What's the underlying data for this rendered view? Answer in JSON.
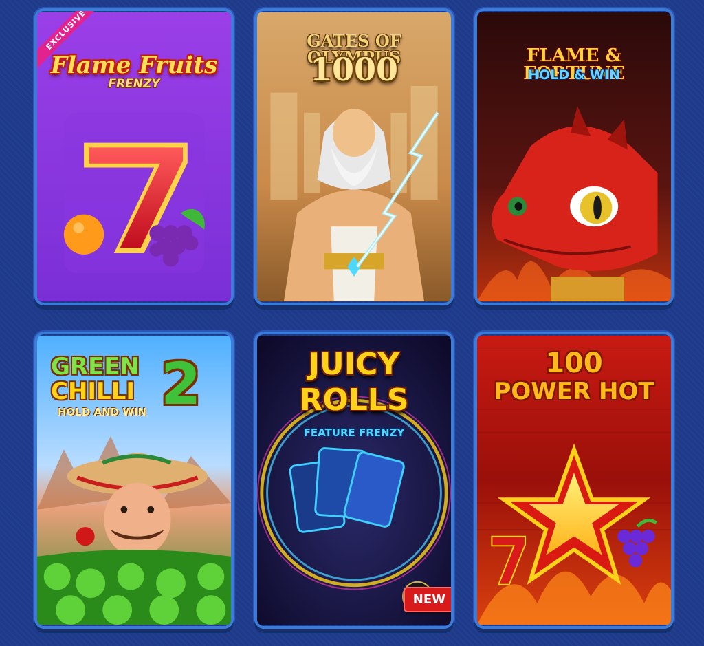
{
  "games": [
    {
      "id": "flame-fruits",
      "title": "Flame Fruits",
      "subtitle": "FRENZY",
      "badge": "EXCLUSIVE"
    },
    {
      "id": "gates-olympus",
      "title": "GATES OF OLYMPUS",
      "subtitle": "1000"
    },
    {
      "id": "flame-fortune",
      "title": "FLAME & FORTUNE",
      "subtitle": "HOLD & WIN"
    },
    {
      "id": "green-chilli",
      "line1": "GREEN",
      "line2": "CHILLI",
      "line3": "HOLD AND WIN",
      "number": "2"
    },
    {
      "id": "juicy-rolls",
      "line1": "JUICY",
      "line2": "ROLLS",
      "line3": "FEATURE FRENZY",
      "badge": "NEW"
    },
    {
      "id": "power-hot",
      "line1": "100",
      "line2": "POWER HOT"
    }
  ],
  "colors": {
    "background": "#1e3a8a",
    "tile_border": "#3d7bd9",
    "new_badge": "#d81a1a",
    "exclusive_badge": "#e3238d"
  }
}
